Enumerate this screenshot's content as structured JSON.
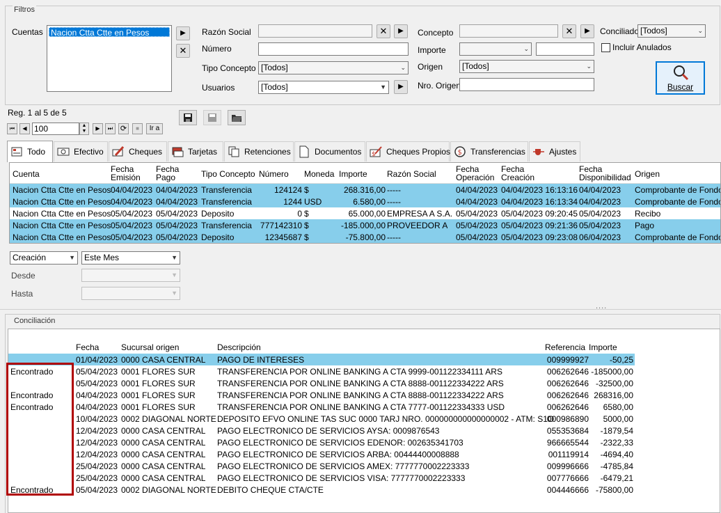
{
  "filtros": {
    "title": "Filtros",
    "cuentas_label": "Cuentas",
    "cuentas_items": [
      "Nacion Ctta Ctte en Pesos"
    ],
    "razon_social_label": "Razón Social",
    "razon_social_value": "",
    "numero_label": "Número",
    "numero_value": "",
    "tipo_concepto_label": "Tipo Concepto",
    "tipo_concepto_value": "[Todos]",
    "usuarios_label": "Usuarios",
    "usuarios_value": "[Todos]",
    "concepto_label": "Concepto",
    "concepto_value": "",
    "importe_label": "Importe",
    "importe_op_value": "",
    "importe_value": "",
    "origen_label": "Origen",
    "origen_value": "[Todos]",
    "nro_origen_label": "Nro. Origen",
    "nro_origen_value": "",
    "conciliado_label": "Conciliado",
    "conciliado_value": "[Todos]",
    "incluir_anulados_label": "Incluir Anulados",
    "buscar_label": "Buscar"
  },
  "nav": {
    "record_status": "Reg. 1 al 5 de 5",
    "page_size": "100",
    "go_label": "Ir a"
  },
  "tabs": [
    {
      "label": "Todo",
      "icon": "document-icon",
      "active": true
    },
    {
      "label": "Efectivo",
      "icon": "cash-icon",
      "active": false
    },
    {
      "label": "Cheques",
      "icon": "cheque-pen-icon",
      "active": false
    },
    {
      "label": "Tarjetas",
      "icon": "card-icon",
      "active": false
    },
    {
      "label": "Retenciones",
      "icon": "stack-icon",
      "active": false
    },
    {
      "label": "Documentos",
      "icon": "doc-icon",
      "active": false
    },
    {
      "label": "Cheques Propios",
      "icon": "dollar-cheque-icon",
      "active": false
    },
    {
      "label": "Transferencias",
      "icon": "transfer-icon",
      "active": false
    },
    {
      "label": "Ajustes",
      "icon": "adjust-icon",
      "active": false
    }
  ],
  "movimientos": {
    "columns": [
      "Cuenta",
      "Fecha Emisión",
      "Fecha Pago",
      "Tipo Concepto",
      "Número",
      "Moneda",
      "Importe",
      "Razón Social",
      "Fecha Operación",
      "Fecha Creación",
      "Fecha Disponibilidad",
      "Origen"
    ],
    "columns_line1": [
      "Cuenta",
      "Fecha",
      "Fecha",
      "Tipo Concepto",
      "Número",
      "Moneda",
      "Importe",
      "Razón Social",
      "Fecha",
      "Fecha",
      "Fecha",
      "Origen"
    ],
    "columns_line2": [
      "",
      "Emisión",
      "Pago",
      "",
      "",
      "",
      "",
      "",
      "Operación",
      "Creación",
      "Disponibilidad",
      ""
    ],
    "rows": [
      {
        "selected": true,
        "cells": [
          "Nacion Ctta Ctte en Pesos",
          "04/04/2023",
          "04/04/2023",
          "Transferencia",
          "124124",
          "$",
          "268.316,00",
          "-----",
          "04/04/2023",
          "04/04/2023 16:13:16",
          "04/04/2023",
          "Comprobante de Fondos"
        ]
      },
      {
        "selected": true,
        "cells": [
          "Nacion Ctta Ctte en Pesos",
          "04/04/2023",
          "04/04/2023",
          "Transferencia",
          "1244",
          "USD",
          "6.580,00",
          "-----",
          "04/04/2023",
          "04/04/2023 16:13:34",
          "04/04/2023",
          "Comprobante de Fondos"
        ]
      },
      {
        "selected": false,
        "cells": [
          "Nacion Ctta Ctte en Pesos",
          "05/04/2023",
          "05/04/2023",
          "Deposito",
          "0",
          "$",
          "65.000,00",
          "EMPRESA A S.A.",
          "05/04/2023",
          "05/04/2023 09:20:45",
          "05/04/2023",
          "Recibo"
        ]
      },
      {
        "selected": true,
        "cells": [
          "Nacion Ctta Ctte en Pesos",
          "05/04/2023",
          "05/04/2023",
          "Transferencia",
          "777142310",
          "$",
          "-185.000,00",
          "PROVEEDOR A",
          "05/04/2023",
          "05/04/2023 09:21:36",
          "05/04/2023",
          "Pago"
        ]
      },
      {
        "selected": true,
        "cells": [
          "Nacion Ctta Ctte en Pesos",
          "05/04/2023",
          "05/04/2023",
          "Deposito",
          "12345687",
          "$",
          "-75.800,00",
          "-----",
          "05/04/2023",
          "05/04/2023 09:23:08",
          "06/04/2023",
          "Comprobante de Fondos"
        ]
      }
    ]
  },
  "fecha_filter": {
    "type_value": "Creación",
    "period_value": "Este Mes",
    "desde_label": "Desde",
    "desde_value": "",
    "hasta_label": "Hasta",
    "hasta_value": ""
  },
  "splitter_glyph": "....",
  "conciliacion": {
    "title": "Conciliación",
    "columns": [
      "",
      "Fecha",
      "Sucursal origen",
      "Descripción",
      "Referencia",
      "Importe"
    ],
    "rows": [
      {
        "selected": true,
        "cells": [
          "",
          "01/04/2023",
          "0000 CASA CENTRAL",
          "PAGO DE INTERESES",
          "009999927",
          "-50,25"
        ]
      },
      {
        "selected": false,
        "cells": [
          "Encontrado",
          "05/04/2023",
          "0001 FLORES SUR",
          "TRANSFERENCIA POR ONLINE BANKING A CTA 9999-001122334111 ARS",
          "006262646",
          "-185000,00"
        ]
      },
      {
        "selected": false,
        "cells": [
          "",
          "05/04/2023",
          "0001 FLORES SUR",
          "TRANSFERENCIA POR ONLINE BANKING A CTA 8888-001122334222 ARS",
          "006262646",
          "-32500,00"
        ]
      },
      {
        "selected": false,
        "cells": [
          "Encontrado",
          "04/04/2023",
          "0001 FLORES SUR",
          "TRANSFERENCIA POR ONLINE BANKING A CTA 8888-001122334222 ARS",
          "006262646",
          "268316,00"
        ]
      },
      {
        "selected": false,
        "cells": [
          "Encontrado",
          "04/04/2023",
          "0001 FLORES SUR",
          "TRANSFERENCIA POR ONLINE BANKING A CTA 7777-001122334333 USD",
          "006262646",
          "6580,00"
        ]
      },
      {
        "selected": false,
        "cells": [
          "",
          "10/04/2023",
          "0002 DIAGONAL NORTE",
          "DEPOSITO EFVO ONLINE TAS SUC 0000 TARJ NRO. 000000000000000002  - ATM: S1O",
          "000986890",
          "5000,00"
        ]
      },
      {
        "selected": false,
        "cells": [
          "",
          "12/04/2023",
          "0000 CASA CENTRAL",
          "PAGO ELECTRONICO DE SERVICIOS   AYSA: 0009876543",
          "055353684",
          "-1879,54"
        ]
      },
      {
        "selected": false,
        "cells": [
          "",
          "12/04/2023",
          "0000 CASA CENTRAL",
          "PAGO ELECTRONICO DE SERVICIOS   EDENOR: 002635341703",
          "966665544",
          "-2322,33"
        ]
      },
      {
        "selected": false,
        "cells": [
          "",
          "12/04/2023",
          "0000 CASA CENTRAL",
          "PAGO ELECTRONICO DE SERVICIOS   ARBA: 00444400008888",
          "001119914",
          "-4694,40"
        ]
      },
      {
        "selected": false,
        "cells": [
          "",
          "25/04/2023",
          "0000 CASA CENTRAL",
          "PAGO ELECTRONICO DE SERVICIOS AMEX: 7777770002223333",
          "009996666",
          "-4785,84"
        ]
      },
      {
        "selected": false,
        "cells": [
          "",
          "25/04/2023",
          "0000 CASA CENTRAL",
          "PAGO ELECTRONICO DE SERVICIOS VISA: 7777770002223333",
          "007776666",
          "-6479,21"
        ]
      },
      {
        "selected": false,
        "cells": [
          "Encontrado",
          "05/04/2023",
          "0002 DIAGONAL NORTE",
          "DEBITO CHEQUE CTA/CTE",
          "004446666",
          "-75800,00"
        ]
      }
    ]
  },
  "colors": {
    "selection": "#87ceeb",
    "highlight_border": "#c00000",
    "accent": "#0078d7"
  }
}
